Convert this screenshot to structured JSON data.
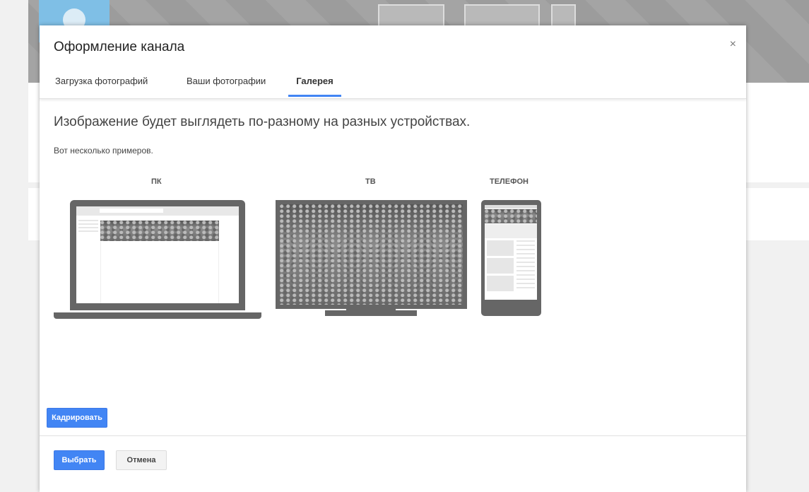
{
  "dialog": {
    "title": "Оформление канала",
    "close": "×",
    "tabs": [
      {
        "label": "Загрузка фотографий"
      },
      {
        "label": "Ваши фотографии"
      },
      {
        "label": "Галерея"
      }
    ],
    "heading": "Изображение будет выглядеть по-разному на разных устройствах.",
    "subtext": "Вот несколько примеров.",
    "devices": {
      "pc": "ПК",
      "tv": "ТВ",
      "phone": "ТЕЛЕФОН"
    },
    "crop_label": "Кадрировать",
    "select_label": "Выбрать",
    "cancel_label": "Отмена"
  },
  "colors": {
    "accent": "#4285f4"
  }
}
